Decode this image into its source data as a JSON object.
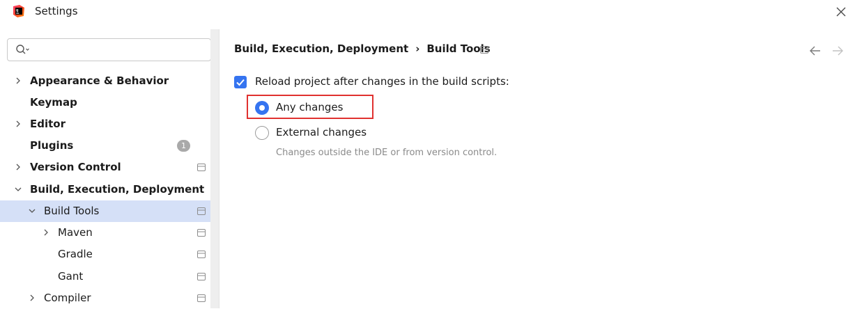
{
  "window": {
    "title": "Settings",
    "app_icon": "intellij-idea-icon",
    "close_icon": "close-icon"
  },
  "sidebar": {
    "search": {
      "placeholder": "",
      "value": "",
      "icon": "search-icon"
    },
    "items": [
      {
        "label": "Appearance & Behavior",
        "bold": true,
        "chevron": "right",
        "indent": 0,
        "badge": "",
        "project_icon": false,
        "selected": false
      },
      {
        "label": "Keymap",
        "bold": true,
        "chevron": "",
        "indent": 0,
        "badge": "",
        "project_icon": false,
        "selected": false
      },
      {
        "label": "Editor",
        "bold": true,
        "chevron": "right",
        "indent": 0,
        "badge": "",
        "project_icon": false,
        "selected": false
      },
      {
        "label": "Plugins",
        "bold": true,
        "chevron": "",
        "indent": 0,
        "badge": "1",
        "project_icon": false,
        "selected": false
      },
      {
        "label": "Version Control",
        "bold": true,
        "chevron": "right",
        "indent": 0,
        "badge": "",
        "project_icon": true,
        "selected": false
      },
      {
        "label": "Build, Execution, Deployment",
        "bold": true,
        "chevron": "down",
        "indent": 0,
        "badge": "",
        "project_icon": false,
        "selected": false
      },
      {
        "label": "Build Tools",
        "bold": false,
        "chevron": "down",
        "indent": 1,
        "badge": "",
        "project_icon": true,
        "selected": true
      },
      {
        "label": "Maven",
        "bold": false,
        "chevron": "right",
        "indent": 2,
        "badge": "",
        "project_icon": true,
        "selected": false
      },
      {
        "label": "Gradle",
        "bold": false,
        "chevron": "",
        "indent": 2,
        "badge": "",
        "project_icon": true,
        "selected": false
      },
      {
        "label": "Gant",
        "bold": false,
        "chevron": "",
        "indent": 2,
        "badge": "",
        "project_icon": true,
        "selected": false
      },
      {
        "label": "Compiler",
        "bold": false,
        "chevron": "right",
        "indent": 1,
        "badge": "",
        "project_icon": true,
        "selected": false
      }
    ]
  },
  "content": {
    "breadcrumb": {
      "parent": "Build, Execution, Deployment",
      "separator": "›",
      "current": "Build Tools"
    },
    "reload_checkbox": {
      "label": "Reload project after changes in the build scripts:",
      "checked": true
    },
    "radio_options": [
      {
        "label": "Any changes",
        "checked": true
      },
      {
        "label": "External changes",
        "checked": false
      }
    ],
    "hint": "Changes outside the IDE or from version control."
  },
  "colors": {
    "accent": "#3574f0",
    "selection": "#d5e0f7",
    "highlight_border": "#e0312f"
  }
}
